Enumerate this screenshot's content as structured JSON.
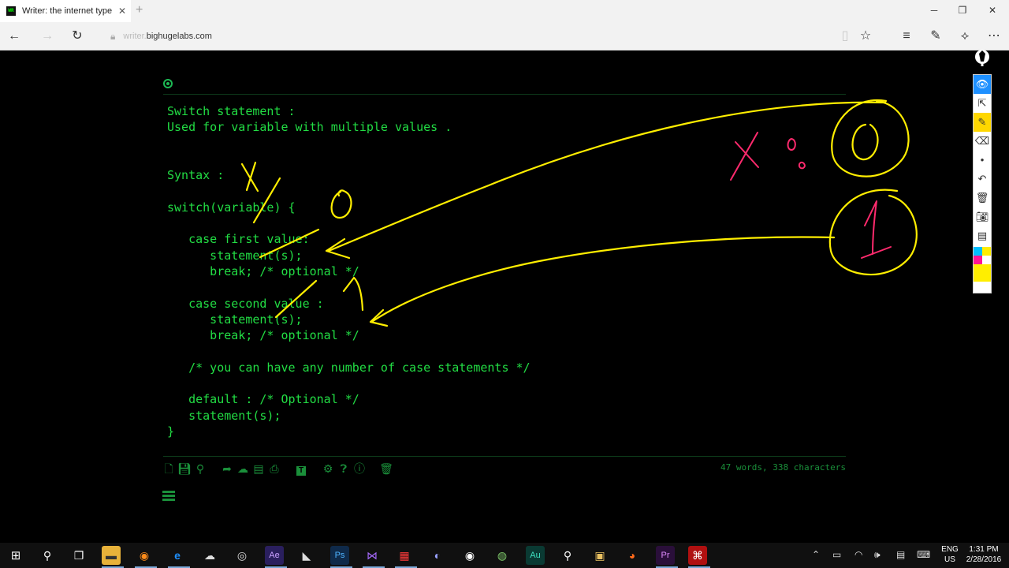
{
  "browser": {
    "tab_title": "Writer: the internet type",
    "tab_close": "✕",
    "new_tab": "+",
    "window_minimize": "─",
    "window_restore": "❐",
    "window_close": "✕",
    "url_prefix": "writer.",
    "url_domain": "bighugelabs.com"
  },
  "editor": {
    "lines": [
      "Switch statement :",
      "Used for variable with multiple values .",
      "",
      "",
      "Syntax :",
      "",
      "switch(variable) {",
      "",
      "   case first value:",
      "      statement(s);",
      "      break; /* optional */",
      "",
      "   case second value :",
      "      statement(s);",
      "      break; /* optional */",
      "",
      "   /* you can have any number of case statements */",
      "",
      "   default : /* Optional */",
      "   statement(s);",
      "}"
    ],
    "status": "47 words, 338 characters"
  },
  "taskbar": {
    "lang_1": "ENG",
    "lang_2": "US",
    "time": "1:31 PM",
    "date": "2/28/2016",
    "apps": [
      "File Explorer",
      "Firefox",
      "Edge",
      "Chat",
      "OBS",
      "After Effects",
      "Visual Studio Code",
      "Photoshop",
      "Visual Studio",
      "App",
      "Eclipse",
      "Media",
      "Android Studio",
      "Audition",
      "Pen",
      "Video",
      "Browser",
      "Premiere",
      "Acrobat"
    ]
  },
  "colors": {
    "code_green": "#22dd44",
    "ink_yellow": "#ffee00",
    "ink_pink": "#ff2a6d"
  }
}
